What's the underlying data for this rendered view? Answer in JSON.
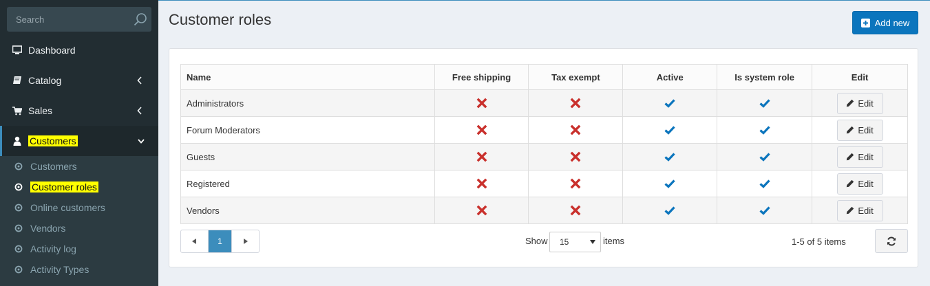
{
  "sidebar": {
    "search_placeholder": "Search",
    "items": [
      {
        "label": "Dashboard",
        "icon": "desktop-icon"
      },
      {
        "label": "Catalog",
        "icon": "book-icon"
      },
      {
        "label": "Sales",
        "icon": "cart-icon"
      },
      {
        "label": "Customers",
        "icon": "user-icon",
        "active": true
      }
    ],
    "submenu": [
      {
        "label": "Customers"
      },
      {
        "label": "Customer roles",
        "current": true
      },
      {
        "label": "Online customers"
      },
      {
        "label": "Vendors"
      },
      {
        "label": "Activity log"
      },
      {
        "label": "Activity Types"
      }
    ]
  },
  "header": {
    "title": "Customer roles",
    "add_label": "Add new"
  },
  "table": {
    "columns": [
      "Name",
      "Free shipping",
      "Tax exempt",
      "Active",
      "Is system role",
      "Edit"
    ],
    "rows": [
      {
        "name": "Administrators",
        "free_shipping": false,
        "tax_exempt": false,
        "active": true,
        "system": true
      },
      {
        "name": "Forum Moderators",
        "free_shipping": false,
        "tax_exempt": false,
        "active": true,
        "system": true
      },
      {
        "name": "Guests",
        "free_shipping": false,
        "tax_exempt": false,
        "active": true,
        "system": true
      },
      {
        "name": "Registered",
        "free_shipping": false,
        "tax_exempt": false,
        "active": true,
        "system": true
      },
      {
        "name": "Vendors",
        "free_shipping": false,
        "tax_exempt": false,
        "active": true,
        "system": true
      }
    ],
    "edit_label": "Edit"
  },
  "pager": {
    "current_page": "1",
    "show_label": "Show",
    "page_size": "15",
    "items_label": "items",
    "count_label": "1-5 of 5 items"
  },
  "colors": {
    "accent": "#3c8dbc",
    "button_primary": "#0b75bd",
    "false_mark": "#c9302c",
    "true_mark": "#0b75bd",
    "highlight": "#ffff00"
  }
}
